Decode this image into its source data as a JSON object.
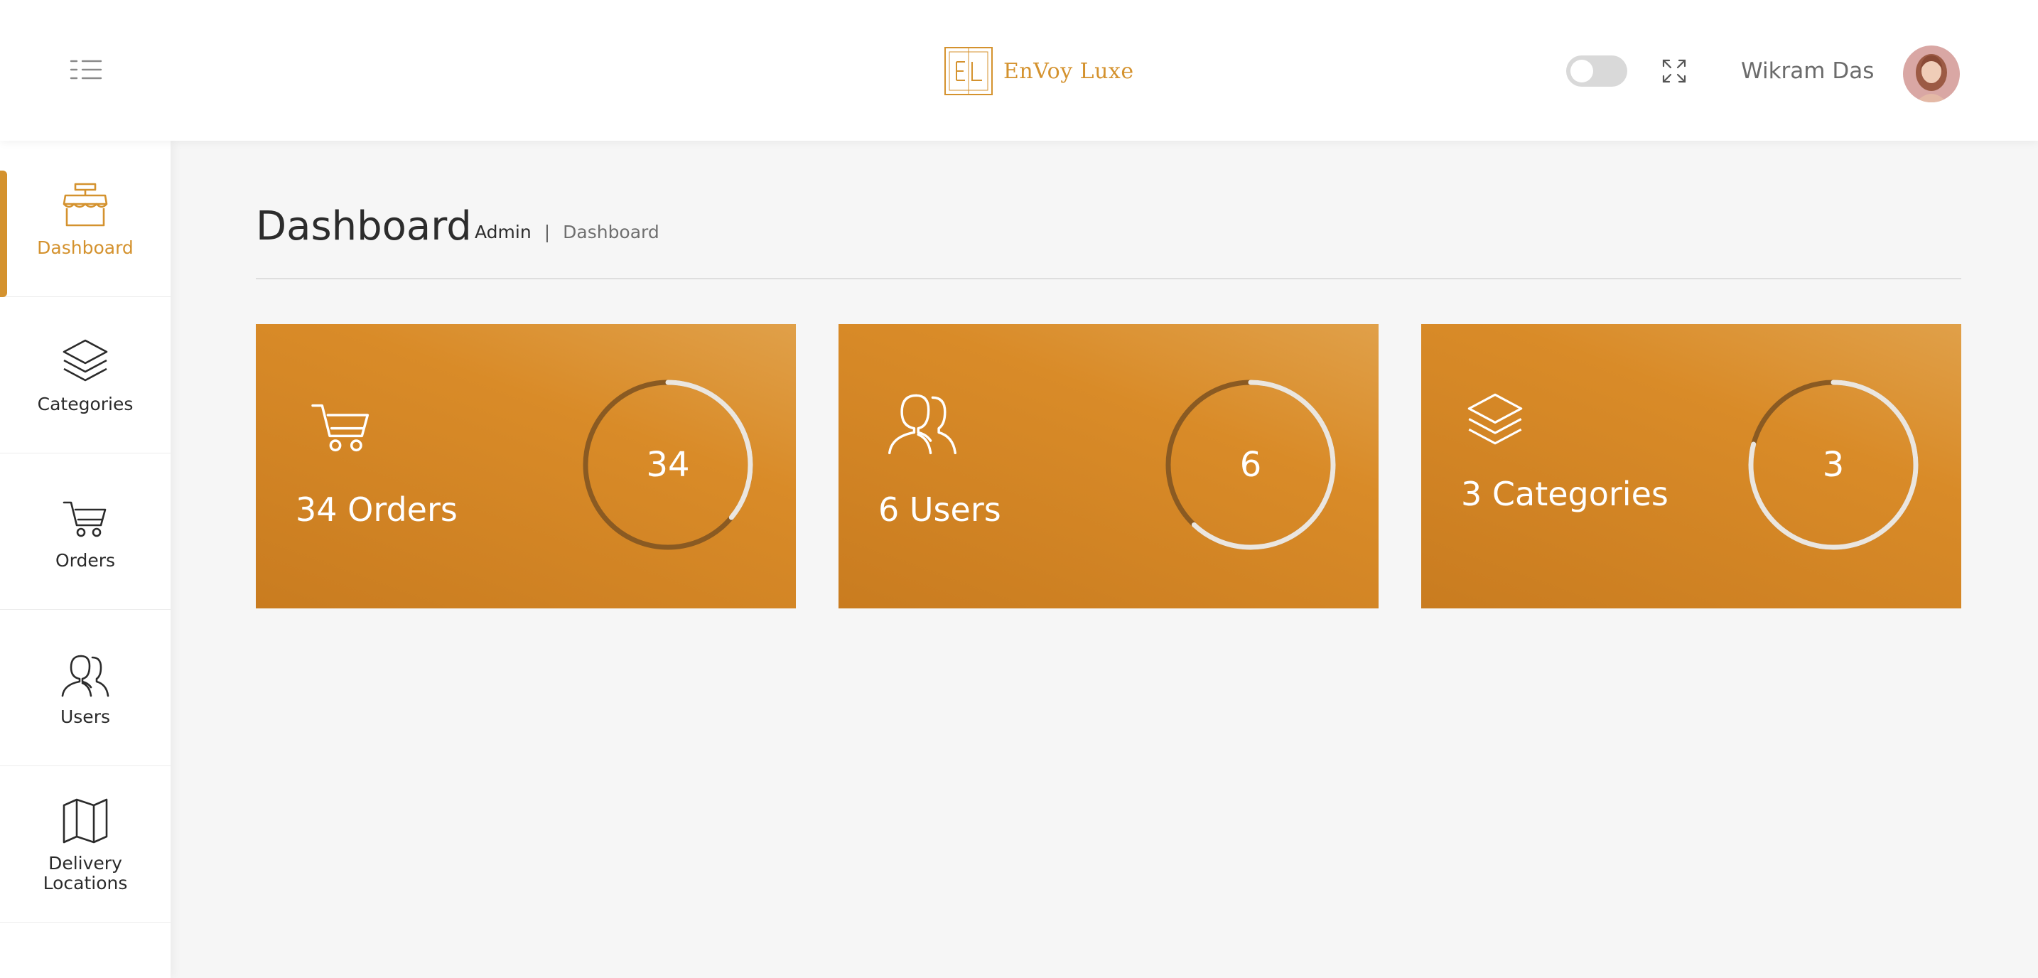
{
  "header": {
    "logo_text": "EnVoy Luxe",
    "user_name": "Wikram Das",
    "theme_toggle": "off"
  },
  "sidebar": {
    "items": [
      {
        "label": "Dashboard",
        "icon": "store-icon",
        "active": true
      },
      {
        "label": "Categories",
        "icon": "layers-icon",
        "active": false
      },
      {
        "label": "Orders",
        "icon": "cart-icon",
        "active": false
      },
      {
        "label": "Users",
        "icon": "users-icon",
        "active": false
      },
      {
        "label": "Delivery Locations",
        "icon": "map-icon",
        "active": false
      }
    ]
  },
  "page": {
    "title": "Dashboard",
    "breadcrumb": {
      "root": "Admin",
      "separator": "|",
      "current": "Dashboard"
    }
  },
  "cards": [
    {
      "label": "34 Orders",
      "value": "34",
      "icon": "cart-icon",
      "progress": 0.36
    },
    {
      "label": "6 Users",
      "value": "6",
      "icon": "users-icon",
      "progress": 0.62
    },
    {
      "label": "3 Categories",
      "value": "3",
      "icon": "layers-icon",
      "progress": 0.79
    }
  ],
  "colors": {
    "accent": "#d4922e",
    "card_gradient_start": "#e0a049",
    "card_gradient_end": "#c97c20",
    "ring_track": "#8a5a22",
    "ring_progress": "#ebe6df"
  }
}
